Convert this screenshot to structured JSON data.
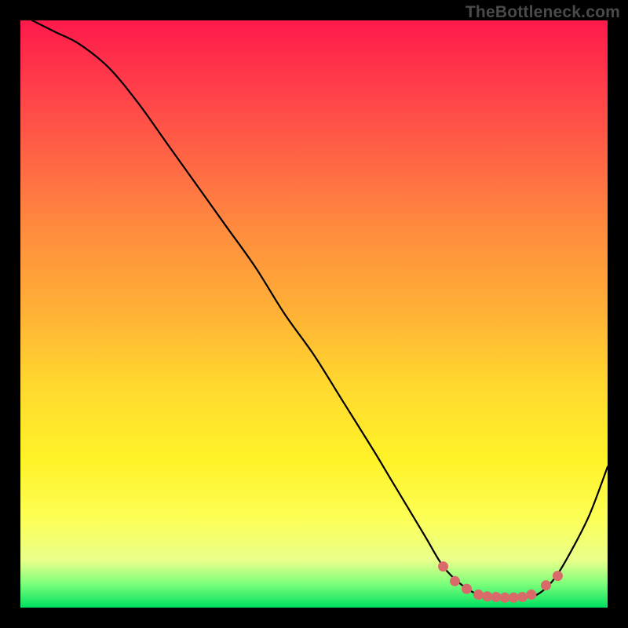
{
  "watermark": "TheBottleneck.com",
  "colors": {
    "frame_bg_top": "#ff1a4b",
    "frame_bg_bottom": "#00e060",
    "curve": "#000000",
    "marker": "#d96a6a",
    "page_bg": "#000000"
  },
  "chart_data": {
    "type": "line",
    "title": "",
    "xlabel": "",
    "ylabel": "",
    "xlim": [
      0,
      100
    ],
    "ylim": [
      0,
      100
    ],
    "series": [
      {
        "name": "bottleneck-curve",
        "x": [
          2,
          6,
          10,
          15,
          20,
          25,
          30,
          35,
          40,
          45,
          50,
          55,
          60,
          63,
          66,
          69,
          72,
          75,
          78,
          81,
          83,
          85,
          88,
          91,
          94,
          97,
          100
        ],
        "values": [
          100,
          98,
          96,
          92,
          86,
          79,
          72,
          65,
          58,
          50,
          43,
          35,
          27,
          22,
          17,
          12,
          7,
          4,
          2.2,
          1.8,
          1.7,
          1.7,
          2.2,
          5,
          10,
          16,
          24
        ]
      }
    ],
    "markers": {
      "name": "optimal-range",
      "x": [
        72,
        74,
        76,
        78,
        79.5,
        81,
        82.5,
        84,
        85.5,
        87,
        89.5,
        91.5
      ],
      "values": [
        7,
        4.5,
        3.2,
        2.2,
        1.9,
        1.8,
        1.7,
        1.7,
        1.8,
        2.2,
        3.8,
        5.4
      ]
    }
  }
}
